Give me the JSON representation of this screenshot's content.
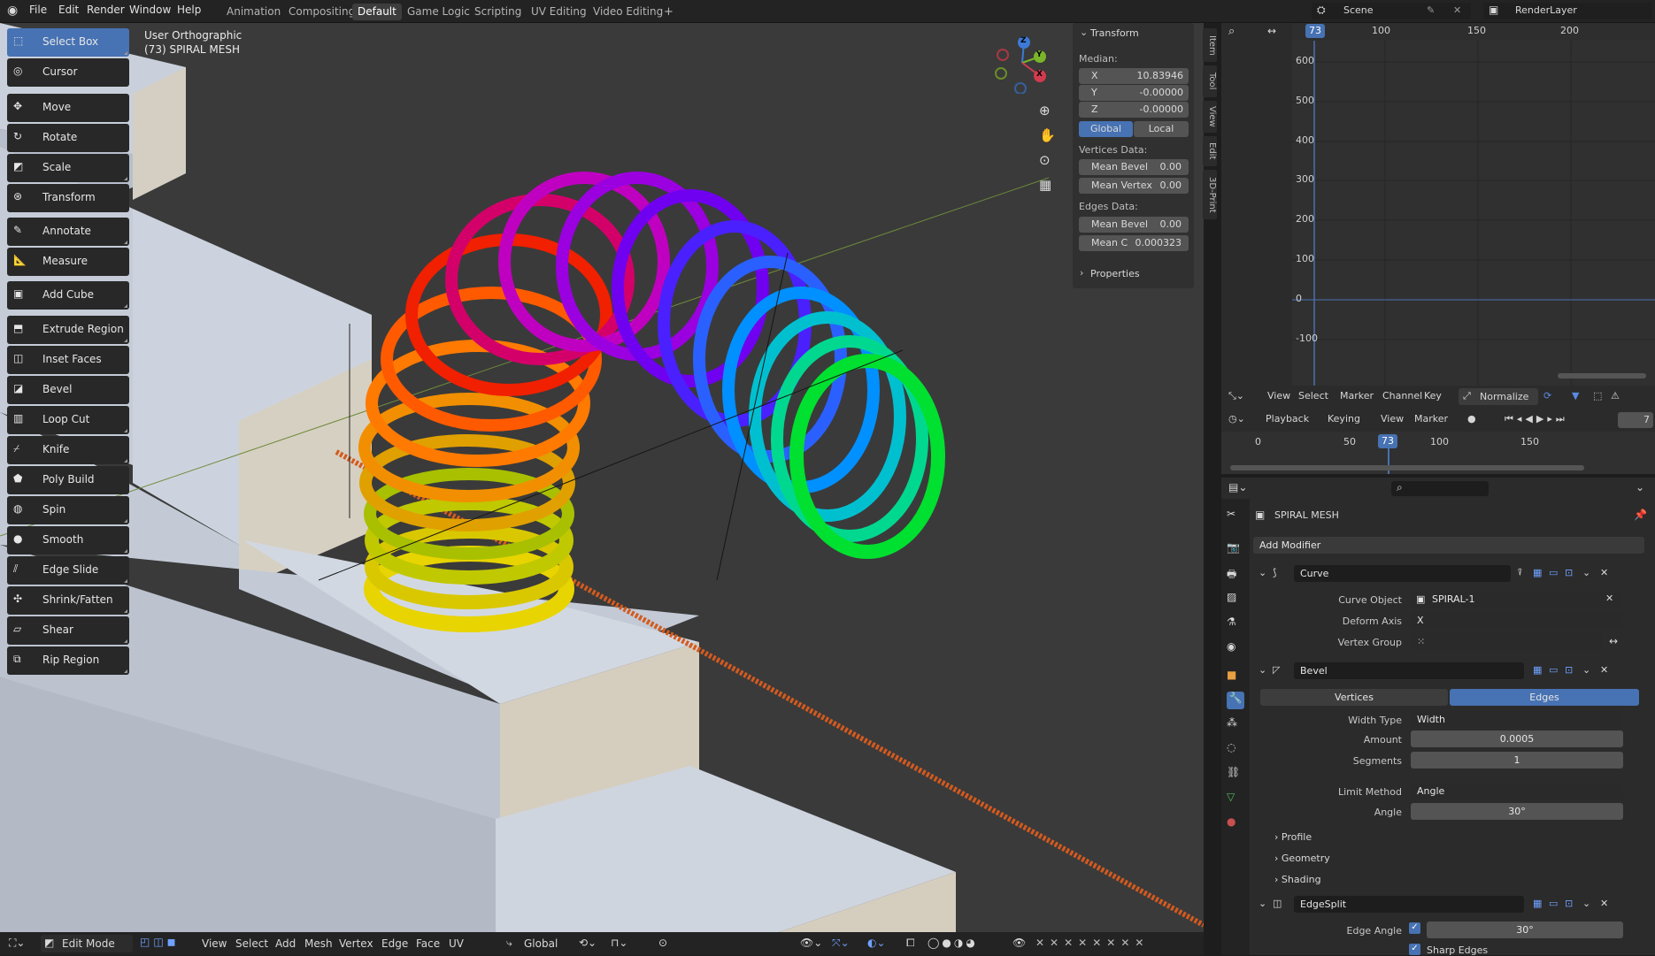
{
  "topbar": {
    "menus": [
      "File",
      "Edit",
      "Render",
      "Window",
      "Help"
    ],
    "workspaces": [
      "Animation",
      "Compositing",
      "Default",
      "Game Logic",
      "Scripting",
      "UV Editing",
      "Video Editing"
    ],
    "active_workspace": "Default",
    "add_tab": "+",
    "scene": "Scene",
    "render_layer": "RenderLayer"
  },
  "viewport": {
    "view_name": "User Orthographic",
    "object_info": "(73) SPIRAL MESH"
  },
  "toolbar": {
    "tools": [
      "Select Box",
      "Cursor",
      "Move",
      "Rotate",
      "Scale",
      "Transform",
      "Annotate",
      "Measure",
      "Add Cube",
      "Extrude Region",
      "Inset Faces",
      "Bevel",
      "Loop Cut",
      "Knife",
      "Poly Build",
      "Spin",
      "Smooth",
      "Edge Slide",
      "Shrink/Fatten",
      "Shear",
      "Rip Region"
    ],
    "active_tool": "Select Box"
  },
  "gizmo": {
    "z": "Z",
    "y": "Y",
    "x": "X"
  },
  "npanel": {
    "title": "Transform",
    "median_label": "Median:",
    "x_label": "X",
    "x_value": "10.83946",
    "y_label": "Y",
    "y_value": "-0.00000",
    "z_label": "Z",
    "z_value": "-0.00000",
    "global": "Global",
    "local": "Local",
    "vertices_data": "Vertices Data:",
    "mean_bevel_label": "Mean Bevel",
    "mean_bevel_value": "0.00",
    "mean_vertex_label": "Mean Vertex",
    "mean_vertex_value": "0.00",
    "edges_data": "Edges Data:",
    "edge_mean_bevel_label": "Mean Bevel",
    "edge_mean_bevel_value": "0.00",
    "mean_c_label": "Mean C",
    "mean_c_value": "0.000323",
    "properties": "Properties",
    "tabs": [
      "Item",
      "Tool",
      "View",
      "Edit",
      "3D-Print"
    ]
  },
  "graph": {
    "frame_marker": "73",
    "x_ticks": [
      "100",
      "150",
      "200"
    ],
    "y_ticks": [
      "600",
      "500",
      "400",
      "300",
      "200",
      "100",
      "0",
      "-100"
    ],
    "menu": [
      "View",
      "Select",
      "Marker",
      "Channel",
      "Key"
    ],
    "normalize": "Normalize"
  },
  "timeline": {
    "menu": [
      "Playback",
      "Keying",
      "View",
      "Marker"
    ],
    "frame_marker": "73",
    "ticks": [
      "0",
      "50",
      "100",
      "150"
    ],
    "current_frame": "7"
  },
  "properties": {
    "object_name": "SPIRAL MESH",
    "add_modifier": "Add Modifier",
    "curve": {
      "name": "Curve",
      "curve_object_label": "Curve Object",
      "curve_object_value": "SPIRAL-1",
      "deform_axis_label": "Deform Axis",
      "deform_axis_value": "X",
      "vertex_group_label": "Vertex Group"
    },
    "bevel": {
      "name": "Bevel",
      "vertices": "Vertices",
      "edges": "Edges",
      "width_type_label": "Width Type",
      "width_type_value": "Width",
      "amount_label": "Amount",
      "amount_value": "0.0005",
      "segments_label": "Segments",
      "segments_value": "1",
      "limit_method_label": "Limit Method",
      "limit_method_value": "Angle",
      "angle_label": "Angle",
      "angle_value": "30°",
      "profile": "Profile",
      "geometry": "Geometry",
      "shading": "Shading"
    },
    "edgesplit": {
      "name": "EdgeSplit",
      "edge_angle_label": "Edge Angle",
      "edge_angle_value": "30°",
      "sharp_edges": "Sharp Edges"
    }
  },
  "bottombar": {
    "mode": "Edit Mode",
    "menus": [
      "View",
      "Select",
      "Add",
      "Mesh",
      "Vertex",
      "Edge",
      "Face",
      "UV"
    ],
    "orientation": "Global"
  }
}
